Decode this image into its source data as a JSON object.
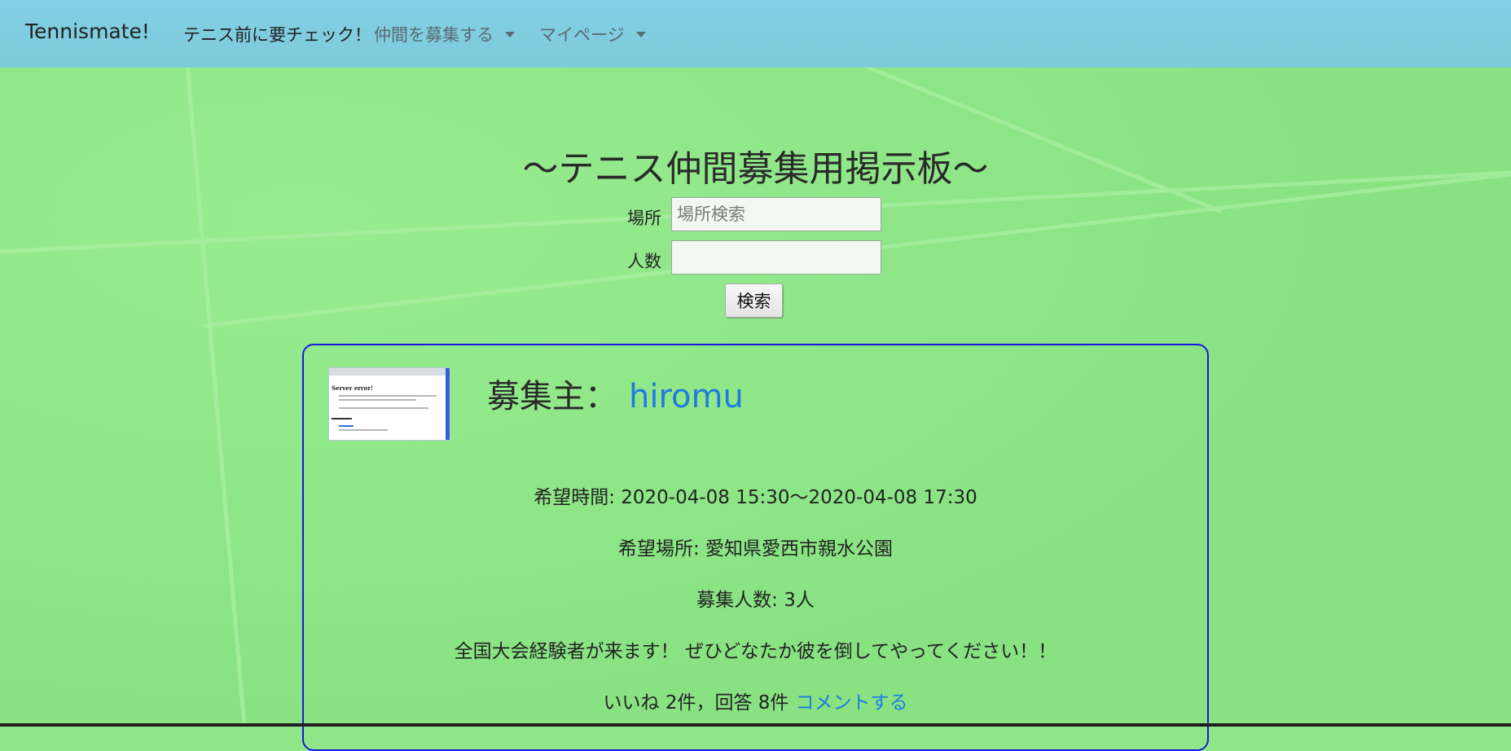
{
  "navbar": {
    "brand": "Tennismate!",
    "items": [
      {
        "label": "テニス前に要チェック！",
        "dropdown": false
      },
      {
        "label": "仲間を募集する",
        "dropdown": true
      },
      {
        "label": "マイページ",
        "dropdown": true
      }
    ]
  },
  "page": {
    "title": "〜テニス仲間募集用掲示板〜"
  },
  "search_form": {
    "place_label": "場所",
    "place_placeholder": "場所検索",
    "place_value": "",
    "count_label": "人数",
    "count_value": "",
    "submit_label": "検索"
  },
  "post": {
    "organizer_label": "募集主：",
    "organizer_name": "hiromu",
    "thumbnail_alt": "Server error!",
    "time_line": "希望時間: 2020-04-08 15:30〜2020-04-08 17:30",
    "place_line": "希望場所: 愛知県愛西市親水公園",
    "count_line": "募集人数: 3人",
    "message": "全国大会経験者が来ます！ ぜひどなたか彼を倒してやってください！！",
    "stats": "いいね 2件，回答 8件",
    "comment_link": "コメントする"
  },
  "colors": {
    "navbar": "#82cfe6",
    "court": "#8fe689",
    "card_border": "#1a1ad6",
    "link": "#1e7be0"
  }
}
